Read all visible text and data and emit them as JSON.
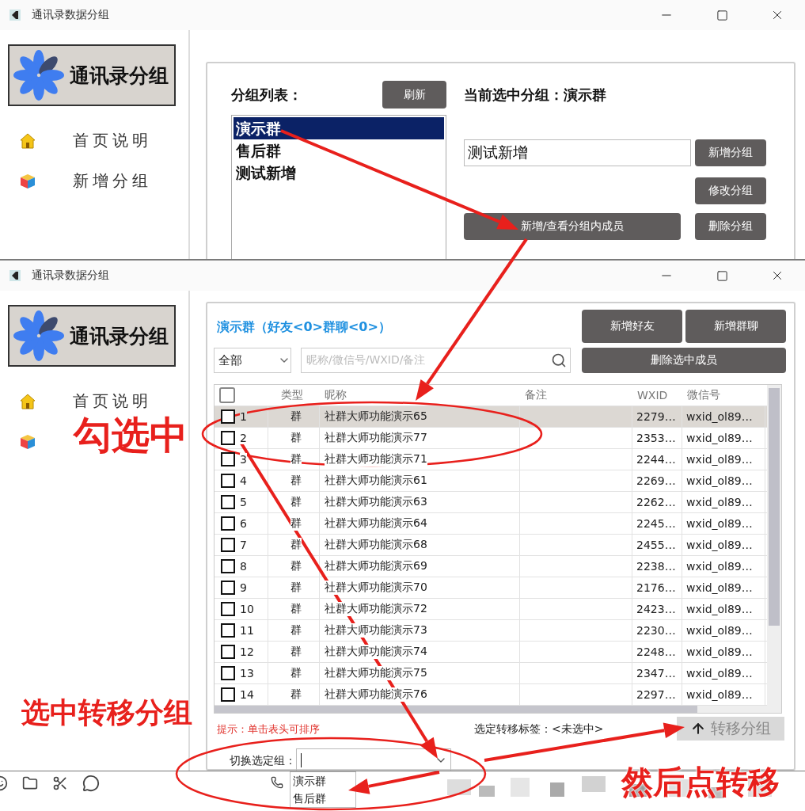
{
  "window_back": {
    "title": "通讯录数据分组",
    "logo": "通讯录分组",
    "sidebar": {
      "items": [
        {
          "kind": "entry",
          "label": "首页说明"
        },
        {
          "kind": "entry",
          "label": "新增分组"
        }
      ]
    },
    "group_list": {
      "label": "分组列表：",
      "refresh": "刷新",
      "items": [
        {
          "label": "演示群",
          "selected": true
        },
        {
          "label": "售后群",
          "selected": false
        },
        {
          "label": "测试新增",
          "selected": false
        }
      ]
    },
    "current": "当前选中分组：演示群",
    "name_field": {
      "value": "测试新增"
    },
    "add_button": "新增分组",
    "edit_button": "修改分组",
    "members_button": "新增/查看分组内成员",
    "delete_button": "删除分组"
  },
  "window_front": {
    "title": "通讯录数据分组",
    "logo": "通讯录分组",
    "sidebar": {
      "items": [
        {
          "kind": "entry",
          "label": "首页说明"
        },
        {
          "kind": "icon_only"
        }
      ]
    },
    "heading": "演示群（好友<0>群聊<0>）",
    "filter": "全部",
    "search": {
      "placeholder": "昵称/微信号/WXID/备注"
    },
    "add_friend_button": "新增好友",
    "add_group_button": "新增群聊",
    "remove_button": "删除选中成员",
    "table": {
      "header_checked": false,
      "columns": [
        "类型",
        "昵称",
        "备注",
        "WXID",
        "微信号"
      ],
      "rows": [
        {
          "no": "1",
          "type": "群",
          "nickname": "社群大师功能演示65",
          "wxid": "2279…",
          "wechat_id": "wxid_ol89…",
          "checked": false,
          "selected": true
        },
        {
          "no": "2",
          "type": "群",
          "nickname": "社群大师功能演示77",
          "wxid": "2353…",
          "wechat_id": "wxid_ol89…",
          "checked": false,
          "selected": false
        },
        {
          "no": "3",
          "type": "群",
          "nickname": "社群大师功能演示71",
          "wxid": "2244…",
          "wechat_id": "wxid_ol89…",
          "checked": false,
          "selected": false
        },
        {
          "no": "4",
          "type": "群",
          "nickname": "社群大师功能演示61",
          "wxid": "2269…",
          "wechat_id": "wxid_ol89…",
          "checked": false,
          "selected": false
        },
        {
          "no": "5",
          "type": "群",
          "nickname": "社群大师功能演示63",
          "wxid": "2262…",
          "wechat_id": "wxid_ol89…",
          "checked": false,
          "selected": false
        },
        {
          "no": "6",
          "type": "群",
          "nickname": "社群大师功能演示64",
          "wxid": "2245…",
          "wechat_id": "wxid_ol89…",
          "checked": false,
          "selected": false
        },
        {
          "no": "7",
          "type": "群",
          "nickname": "社群大师功能演示68",
          "wxid": "2455…",
          "wechat_id": "wxid_ol89…",
          "checked": false,
          "selected": false
        },
        {
          "no": "8",
          "type": "群",
          "nickname": "社群大师功能演示69",
          "wxid": "2238…",
          "wechat_id": "wxid_ol89…",
          "checked": false,
          "selected": false
        },
        {
          "no": "9",
          "type": "群",
          "nickname": "社群大师功能演示70",
          "wxid": "2176…",
          "wechat_id": "wxid_ol89…",
          "checked": false,
          "selected": false
        },
        {
          "no": "10",
          "type": "群",
          "nickname": "社群大师功能演示72",
          "wxid": "2423…",
          "wechat_id": "wxid_ol89…",
          "checked": false,
          "selected": false
        },
        {
          "no": "11",
          "type": "群",
          "nickname": "社群大师功能演示73",
          "wxid": "2230…",
          "wechat_id": "wxid_ol89…",
          "checked": false,
          "selected": false
        },
        {
          "no": "12",
          "type": "群",
          "nickname": "社群大师功能演示74",
          "wxid": "2248…",
          "wechat_id": "wxid_ol89…",
          "checked": false,
          "selected": false
        },
        {
          "no": "13",
          "type": "群",
          "nickname": "社群大师功能演示75",
          "wxid": "2347…",
          "wechat_id": "wxid_ol89…",
          "checked": false,
          "selected": false
        },
        {
          "no": "14",
          "type": "群",
          "nickname": "社群大师功能演示76",
          "wxid": "2297…",
          "wechat_id": "wxid_ol89…",
          "checked": false,
          "selected": false
        }
      ]
    },
    "hint": "提示：单击表头可排序",
    "transfer_label": "选定转移标签：<未选中>",
    "transfer_button": {
      "label": "转移分组",
      "disabled": true
    },
    "switch_group": {
      "label": "切换选定组：",
      "options": [
        "演示群",
        "售后群"
      ]
    }
  },
  "annotations": [
    "勾选中",
    "选中转移分组",
    "然后点转移"
  ]
}
